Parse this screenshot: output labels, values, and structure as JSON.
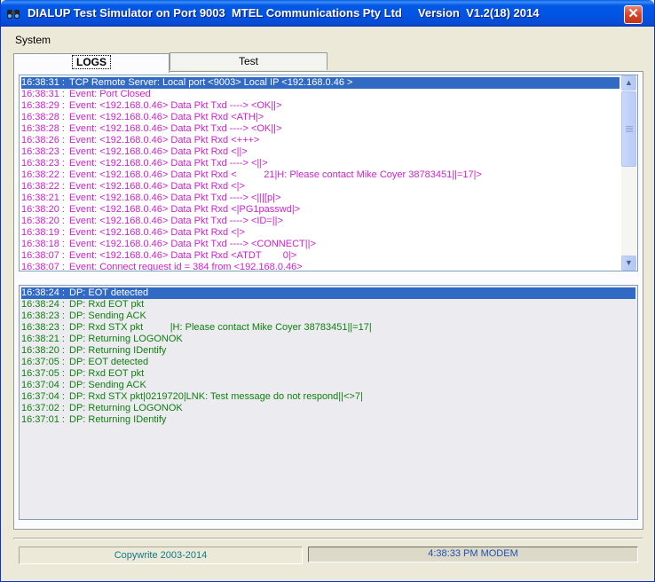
{
  "window": {
    "title": "DIALUP Test Simulator on Port 9003  MTEL Communications Pty Ltd     Version  V1.2(18) 2014",
    "close_label": "✕"
  },
  "menu": {
    "items": [
      {
        "label": "System"
      }
    ]
  },
  "tabs": [
    {
      "label": "LOGS",
      "active": true
    },
    {
      "label": "Test",
      "active": false
    }
  ],
  "event_log": {
    "rows": [
      {
        "time": "16:38:31 :",
        "text": "TCP Remote Server: Local port <9003> Local IP <192.168.0.46 >",
        "selected": true
      },
      {
        "time": "16:38:31 :",
        "text": "Event: Port Closed"
      },
      {
        "time": "16:38:29 :",
        "text": "Event: <192.168.0.46> Data Pkt Txd ----> <OK||>"
      },
      {
        "time": "16:38:28 :",
        "text": "Event: <192.168.0.46> Data Pkt Rxd <ATH|>"
      },
      {
        "time": "16:38:28 :",
        "text": "Event: <192.168.0.46> Data Pkt Txd ----> <OK||>"
      },
      {
        "time": "16:38:26 :",
        "text": "Event: <192.168.0.46> Data Pkt Rxd <+++>"
      },
      {
        "time": "16:38:23 :",
        "text": "Event: <192.168.0.46> Data Pkt Rxd <||>"
      },
      {
        "time": "16:38:23 :",
        "text": "Event: <192.168.0.46> Data Pkt Txd ----> <||>"
      },
      {
        "time": "16:38:22 :",
        "text": "Event: <192.168.0.46> Data Pkt Rxd <          21|H: Please contact Mike Coyer 38783451||=17|>"
      },
      {
        "time": "16:38:22 :",
        "text": "Event: <192.168.0.46> Data Pkt Rxd <|>"
      },
      {
        "time": "16:38:21 :",
        "text": "Event: <192.168.0.46> Data Pkt Txd ----> <|||[p|>"
      },
      {
        "time": "16:38:20 :",
        "text": "Event: <192.168.0.46> Data Pkt Rxd <|PG1passwd|>"
      },
      {
        "time": "16:38:20 :",
        "text": "Event: <192.168.0.46> Data Pkt Txd ----> <ID=||>"
      },
      {
        "time": "16:38:19 :",
        "text": "Event: <192.168.0.46> Data Pkt Rxd <|>"
      },
      {
        "time": "16:38:18 :",
        "text": "Event: <192.168.0.46> Data Pkt Txd ----> <CONNECT||>"
      },
      {
        "time": "16:38:07 :",
        "text": "Event: <192.168.0.46> Data Pkt Rxd <ATDT        0|>"
      },
      {
        "time": "16:38:07 :",
        "text": "Event: Connect request id = 384 from <192.168.0.46>"
      }
    ]
  },
  "dp_log": {
    "rows": [
      {
        "time": "16:38:24 :",
        "text": "DP: EOT detected",
        "selected": true
      },
      {
        "time": "16:38:24 :",
        "text": "DP: Rxd EOT pkt"
      },
      {
        "time": "16:38:23 :",
        "text": "DP: Sending ACK"
      },
      {
        "time": "16:38:23 :",
        "text": "DP: Rxd STX pkt          |H: Please contact Mike Coyer 38783451||=17|"
      },
      {
        "time": "16:38:21 :",
        "text": "DP: Returning LOGONOK"
      },
      {
        "time": "16:38:20 :",
        "text": "DP: Returning IDentify"
      },
      {
        "time": "16:37:05 :",
        "text": "DP: EOT detected"
      },
      {
        "time": "16:37:05 :",
        "text": "DP: Rxd EOT pkt"
      },
      {
        "time": "16:37:04 :",
        "text": "DP: Sending ACK"
      },
      {
        "time": "16:37:04 :",
        "text": "DP: Rxd STX pkt|0219720|LNK: Test message do not respond||<>7|"
      },
      {
        "time": "16:37:02 :",
        "text": "DP: Returning LOGONOK"
      },
      {
        "time": "16:37:01 :",
        "text": "DP: Returning IDentify"
      }
    ]
  },
  "scrollbar": {
    "up_icon": "▲",
    "down_icon": "▼"
  },
  "status": {
    "left": "Copywrite 2003-2014",
    "right": "4:38:33 PM MODEM"
  },
  "colors": {
    "event_text": "#d020d0",
    "dp_text": "#108010",
    "selection": "#316ac5",
    "title_bar": "#0054e3"
  }
}
